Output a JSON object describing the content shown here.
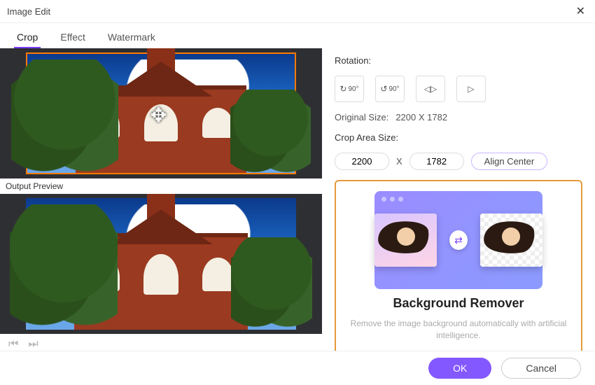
{
  "window": {
    "title": "Image Edit"
  },
  "tabs": {
    "crop": "Crop",
    "effect": "Effect",
    "watermark": "Watermark"
  },
  "preview_label": "Output Preview",
  "rotation": {
    "label": "Rotation:",
    "btn_cw": "90°",
    "btn_ccw": "90°"
  },
  "original_size": {
    "label": "Original Size:",
    "value": "2200 X 1782"
  },
  "crop_area": {
    "label": "Crop Area Size:",
    "w": "2200",
    "sep": "X",
    "h": "1782",
    "align": "Align Center"
  },
  "promo": {
    "title": "Background Remover",
    "subtitle": "Remove the image background automatically with artificial intelligence."
  },
  "footer": {
    "ok": "OK",
    "cancel": "Cancel"
  }
}
